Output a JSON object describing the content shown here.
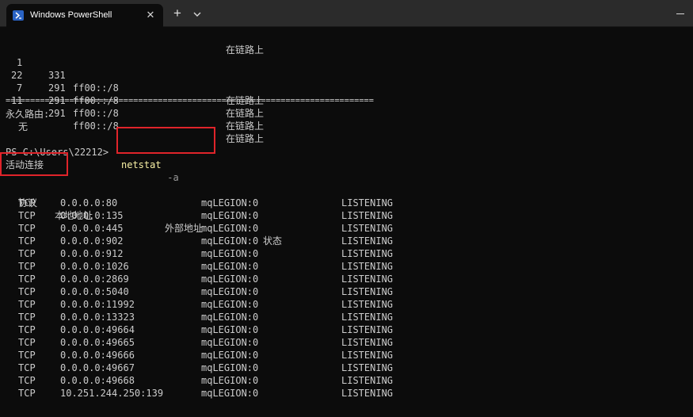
{
  "window": {
    "tab_title": "Windows PowerShell",
    "new_tab_symbol": "+",
    "close_symbol": "✕",
    "icons": [
      "powershell-icon",
      "close-icon",
      "plus-icon",
      "chevron-down-icon",
      "minimize-icon"
    ]
  },
  "route_table": {
    "top_status": "在链路上",
    "rows": [
      {
        "ifidx": "1",
        "metric": "331",
        "dest": "ff00::/8",
        "status": "在链路上"
      },
      {
        "ifidx": "22",
        "metric": "291",
        "dest": "ff00::/8",
        "status": "在链路上"
      },
      {
        "ifidx": "7",
        "metric": "291",
        "dest": "ff00::/8",
        "status": "在链路上"
      },
      {
        "ifidx": "11",
        "metric": "291",
        "dest": "ff00::/8",
        "status": "在链路上"
      }
    ],
    "separator": "===========================================================================",
    "persistent_label": "永久路由:",
    "persistent_value": "无"
  },
  "prompt": {
    "path": "PS C:\\Users\\22212> ",
    "command": "netstat",
    "argument": " -a"
  },
  "netstat": {
    "heading": "活动连接",
    "headers": {
      "proto": "协议",
      "local": "本地地址",
      "foreign": "外部地址",
      "state": "状态"
    },
    "rows": [
      {
        "proto": "TCP",
        "local": "0.0.0.0:80",
        "foreign": "mqLEGION:0",
        "state": "LISTENING"
      },
      {
        "proto": "TCP",
        "local": "0.0.0.0:135",
        "foreign": "mqLEGION:0",
        "state": "LISTENING"
      },
      {
        "proto": "TCP",
        "local": "0.0.0.0:445",
        "foreign": "mqLEGION:0",
        "state": "LISTENING"
      },
      {
        "proto": "TCP",
        "local": "0.0.0.0:902",
        "foreign": "mqLEGION:0",
        "state": "LISTENING"
      },
      {
        "proto": "TCP",
        "local": "0.0.0.0:912",
        "foreign": "mqLEGION:0",
        "state": "LISTENING"
      },
      {
        "proto": "TCP",
        "local": "0.0.0.0:1026",
        "foreign": "mqLEGION:0",
        "state": "LISTENING"
      },
      {
        "proto": "TCP",
        "local": "0.0.0.0:2869",
        "foreign": "mqLEGION:0",
        "state": "LISTENING"
      },
      {
        "proto": "TCP",
        "local": "0.0.0.0:5040",
        "foreign": "mqLEGION:0",
        "state": "LISTENING"
      },
      {
        "proto": "TCP",
        "local": "0.0.0.0:11992",
        "foreign": "mqLEGION:0",
        "state": "LISTENING"
      },
      {
        "proto": "TCP",
        "local": "0.0.0.0:13323",
        "foreign": "mqLEGION:0",
        "state": "LISTENING"
      },
      {
        "proto": "TCP",
        "local": "0.0.0.0:49664",
        "foreign": "mqLEGION:0",
        "state": "LISTENING"
      },
      {
        "proto": "TCP",
        "local": "0.0.0.0:49665",
        "foreign": "mqLEGION:0",
        "state": "LISTENING"
      },
      {
        "proto": "TCP",
        "local": "0.0.0.0:49666",
        "foreign": "mqLEGION:0",
        "state": "LISTENING"
      },
      {
        "proto": "TCP",
        "local": "0.0.0.0:49667",
        "foreign": "mqLEGION:0",
        "state": "LISTENING"
      },
      {
        "proto": "TCP",
        "local": "0.0.0.0:49668",
        "foreign": "mqLEGION:0",
        "state": "LISTENING"
      },
      {
        "proto": "TCP",
        "local": "10.251.244.250:139",
        "foreign": "mqLEGION:0",
        "state": "LISTENING"
      }
    ]
  },
  "colors": {
    "background": "#0c0c0c",
    "text": "#cccccc",
    "command": "#f9f1a5",
    "parameter": "#9a9a9a",
    "highlight_box": "#e0242a"
  }
}
